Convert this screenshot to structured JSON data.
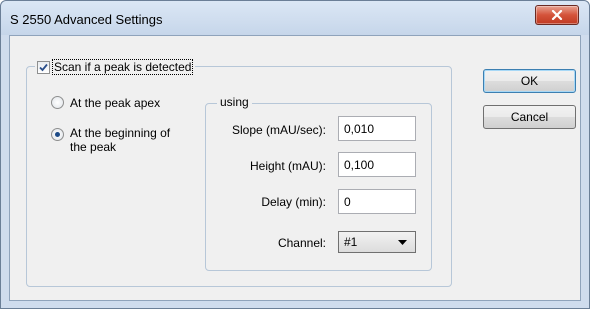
{
  "window": {
    "title": "S 2550 Advanced Settings"
  },
  "scan_group": {
    "checkbox_label": "Scan if a peak is detected",
    "checked": true,
    "radios": [
      {
        "label": "At the peak apex",
        "selected": false
      },
      {
        "label_line1": "At the beginning of",
        "label_line2": "the peak",
        "selected": true
      }
    ]
  },
  "using_group": {
    "legend": "using",
    "slope": {
      "label": "Slope (mAU/sec):",
      "value": "0,010"
    },
    "height": {
      "label": "Height (mAU):",
      "value": "0,100"
    },
    "delay": {
      "label": "Delay (min):",
      "value": "0"
    },
    "channel": {
      "label": "Channel:",
      "value": "#1"
    }
  },
  "buttons": {
    "ok": "OK",
    "cancel": "Cancel"
  },
  "colors": {
    "accent": "#3c7fb1",
    "close": "#c03a22"
  }
}
